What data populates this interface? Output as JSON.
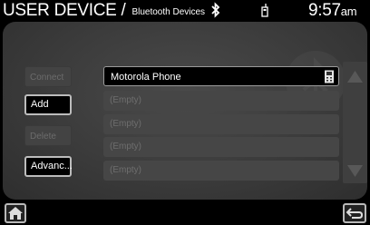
{
  "header": {
    "title": "USER DEVICE /",
    "subtitle": "Bluetooth Devices",
    "clock": "9:57",
    "clock_suffix": "am",
    "status_icons": [
      "bluetooth-icon",
      "phone-signal-icon"
    ]
  },
  "sidebar": {
    "buttons": [
      {
        "label": "Connect",
        "enabled": false
      },
      {
        "label": "Add",
        "enabled": true
      },
      {
        "label": "Delete",
        "enabled": false
      },
      {
        "label": "Advanc...",
        "enabled": true
      }
    ]
  },
  "device_list": {
    "items": [
      {
        "label": "Motorola Phone",
        "selected": true,
        "icon": "phone-icon"
      },
      {
        "label": "(Empty)",
        "selected": false
      },
      {
        "label": "(Empty)",
        "selected": false
      },
      {
        "label": "(Empty)",
        "selected": false
      },
      {
        "label": "(Empty)",
        "selected": false
      }
    ]
  },
  "scrollbar": {
    "up_icon": "arrow-up-icon",
    "down_icon": "arrow-down-icon"
  },
  "footer": {
    "home_icon": "home-icon",
    "back_icon": "back-icon"
  },
  "colors": {
    "background": "#000000",
    "panel": "#3b3b3b",
    "selected_row": "#000000",
    "empty_row": "#464646",
    "text": "#ffffff"
  }
}
